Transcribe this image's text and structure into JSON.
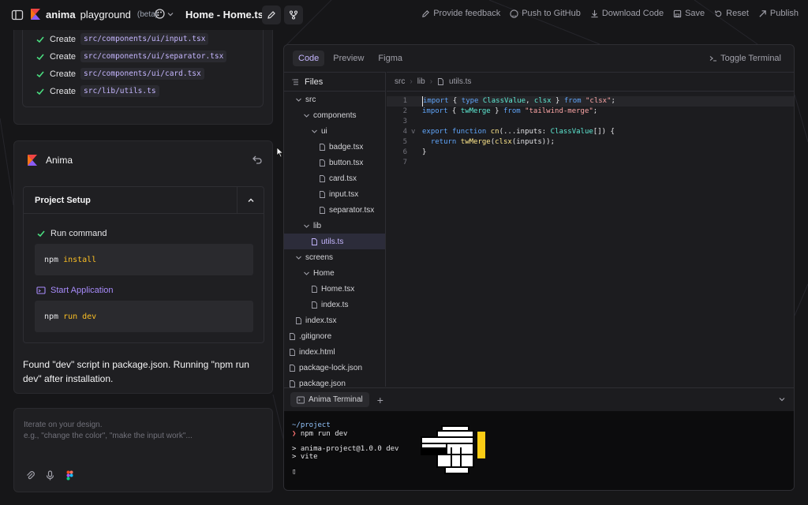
{
  "topbar": {
    "brand": "anima",
    "product": "playground",
    "beta": "(beta)",
    "file_title": "Home - Home.tsx",
    "actions": [
      {
        "label": "Provide feedback",
        "icon": "pencil-icon"
      },
      {
        "label": "Push to GitHub",
        "icon": "github-icon"
      },
      {
        "label": "Download Code",
        "icon": "download-icon"
      },
      {
        "label": "Save",
        "icon": "save-icon"
      },
      {
        "label": "Reset",
        "icon": "reset-icon"
      },
      {
        "label": "Publish",
        "icon": "publish-icon"
      }
    ]
  },
  "tasks": [
    {
      "label": "Create",
      "path": "src/components/ui/input.tsx"
    },
    {
      "label": "Create",
      "path": "src/components/ui/separator.tsx"
    },
    {
      "label": "Create",
      "path": "src/components/ui/card.tsx"
    },
    {
      "label": "Create",
      "path": "src/lib/utils.ts"
    }
  ],
  "anima": {
    "name": "Anima",
    "setup_title": "Project Setup",
    "step1_label": "Run command",
    "step1_cmd": "npm",
    "step1_arg": "install",
    "step2_label": "Start Application",
    "step2_cmd": "npm",
    "step2_arg": "run dev",
    "message": "Found \"dev\" script in package.json. Running \"npm run dev\" after installation."
  },
  "prompt": {
    "placeholder_line1": "Iterate on your design.",
    "placeholder_line2": "e.g., \"change the color\", \"make the input work\"..."
  },
  "editor": {
    "tabs": [
      "Code",
      "Preview",
      "Figma"
    ],
    "active_tab": "Code",
    "toggle_terminal": "Toggle Terminal",
    "files_label": "Files",
    "breadcrumb": [
      "src",
      "lib",
      "utils.ts"
    ],
    "tree": [
      {
        "name": "src",
        "type": "folder"
      },
      {
        "name": "components",
        "type": "folder"
      },
      {
        "name": "ui",
        "type": "folder"
      },
      {
        "name": "badge.tsx",
        "type": "file"
      },
      {
        "name": "button.tsx",
        "type": "file"
      },
      {
        "name": "card.tsx",
        "type": "file"
      },
      {
        "name": "input.tsx",
        "type": "file"
      },
      {
        "name": "separator.tsx",
        "type": "file"
      },
      {
        "name": "lib",
        "type": "folder"
      },
      {
        "name": "utils.ts",
        "type": "file",
        "selected": true
      },
      {
        "name": "screens",
        "type": "folder"
      },
      {
        "name": "Home",
        "type": "folder"
      },
      {
        "name": "Home.tsx",
        "type": "file"
      },
      {
        "name": "index.ts",
        "type": "file"
      },
      {
        "name": "index.tsx",
        "type": "file"
      },
      {
        "name": ".gitignore",
        "type": "file"
      },
      {
        "name": "index.html",
        "type": "file"
      },
      {
        "name": "package-lock.json",
        "type": "file"
      },
      {
        "name": "package.json",
        "type": "file"
      }
    ],
    "code_lines": [
      {
        "n": "1",
        "fold": "",
        "tokens": [
          [
            "kw",
            "import"
          ],
          [
            "id",
            " { "
          ],
          [
            "kw",
            "type"
          ],
          [
            "id",
            " "
          ],
          [
            "ty",
            "ClassValue"
          ],
          [
            "id",
            ", "
          ],
          [
            "ty",
            "clsx"
          ],
          [
            "id",
            " } "
          ],
          [
            "kw",
            "from"
          ],
          [
            "id",
            " "
          ],
          [
            "str",
            "\"clsx\""
          ],
          [
            "id",
            ";"
          ]
        ]
      },
      {
        "n": "2",
        "fold": "",
        "tokens": [
          [
            "kw",
            "import"
          ],
          [
            "id",
            " { "
          ],
          [
            "ty",
            "twMerge"
          ],
          [
            "id",
            " } "
          ],
          [
            "kw",
            "from"
          ],
          [
            "id",
            " "
          ],
          [
            "str",
            "\"tailwind-merge\""
          ],
          [
            "id",
            ";"
          ]
        ]
      },
      {
        "n": "3",
        "fold": "",
        "tokens": []
      },
      {
        "n": "4",
        "fold": "v",
        "tokens": [
          [
            "kw",
            "export"
          ],
          [
            "id",
            " "
          ],
          [
            "kw",
            "function"
          ],
          [
            "id",
            " "
          ],
          [
            "fn",
            "cn"
          ],
          [
            "id",
            "(..."
          ],
          [
            "id",
            "inputs"
          ],
          [
            "id",
            ": "
          ],
          [
            "ty",
            "ClassValue"
          ],
          [
            "id",
            "[]) {"
          ]
        ]
      },
      {
        "n": "5",
        "fold": "",
        "tokens": [
          [
            "id",
            "  "
          ],
          [
            "kw",
            "return"
          ],
          [
            "id",
            " "
          ],
          [
            "fn",
            "twMerge"
          ],
          [
            "id",
            "("
          ],
          [
            "fn",
            "clsx"
          ],
          [
            "id",
            "(inputs));"
          ]
        ]
      },
      {
        "n": "6",
        "fold": "",
        "tokens": [
          [
            "id",
            "}"
          ]
        ]
      },
      {
        "n": "7",
        "fold": "",
        "tokens": []
      }
    ]
  },
  "terminal": {
    "tab_label": "Anima Terminal",
    "cwd": "~/project",
    "prompt_symbol": "❯",
    "command": "npm run dev",
    "out1": "> anima-project@1.0.0 dev",
    "out2": "> vite",
    "cursor": "▯"
  }
}
